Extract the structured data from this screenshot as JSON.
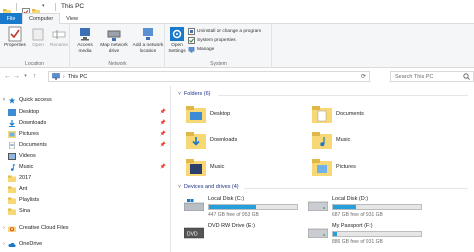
{
  "window": {
    "title": "This PC"
  },
  "tabs": {
    "file": "File",
    "computer": "Computer",
    "view": "View"
  },
  "ribbon": {
    "location": {
      "label": "Location",
      "properties": "Properties",
      "open": "Open",
      "rename": "Rename"
    },
    "network": {
      "label": "Network",
      "access_media": "Access media",
      "map_drive": "Map network drive",
      "add_location": "Add a network location"
    },
    "system": {
      "label": "System",
      "open_settings": "Open Settings",
      "uninstall": "Uninstall or change a program",
      "system_properties": "System properties",
      "manage": "Manage"
    }
  },
  "address": {
    "path": "This PC",
    "search_placeholder": "Search This PC"
  },
  "nav": {
    "quick_access": "Quick access",
    "items": [
      "Desktop",
      "Downloads",
      "Pictures",
      "Documents",
      "Videos",
      "Music",
      "2017",
      "Ant",
      "Playlists",
      "Sina"
    ],
    "creative_cloud": "Creative Cloud Files",
    "onedrive": "OneDrive"
  },
  "folders": {
    "heading": "Folders (6)",
    "items": [
      "Desktop",
      "Documents",
      "Downloads",
      "Music",
      "Music",
      "Pictures"
    ]
  },
  "drives": {
    "heading": "Devices and drives (4)",
    "items": [
      {
        "name": "Local Disk (C:)",
        "free": "447 GB free of 953 GB",
        "used_fraction": 0.53
      },
      {
        "name": "Local Disk (D:)",
        "free": "687 GB free of 931 GB",
        "used_fraction": 0.26
      },
      {
        "name": "DVD RW Drive (E:)",
        "free": "",
        "used_fraction": 0
      },
      {
        "name": "My Passport (F:)",
        "free": "886 GB free of 931 GB",
        "used_fraction": 0.05
      }
    ]
  },
  "colors": {
    "accent": "#1979ca",
    "folder": "#f8d775",
    "bar": "#26a0da"
  }
}
